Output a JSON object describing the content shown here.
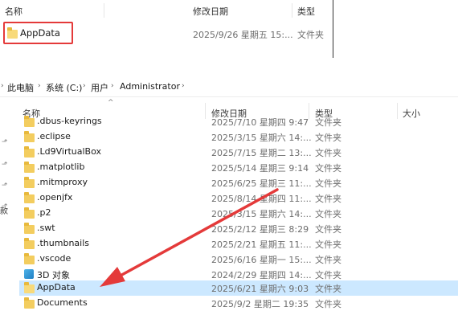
{
  "top_panel": {
    "columns": {
      "name": "名称",
      "date": "修改日期",
      "type": "类型"
    },
    "row": {
      "name": "AppData",
      "date": "2025/9/26 星期五 15:...",
      "type": "文件夹"
    },
    "highlight_color": "#e43a3a"
  },
  "breadcrumb": {
    "items": [
      "此电脑",
      "系统 (C:)",
      "用户",
      "Administrator"
    ],
    "separator": ">"
  },
  "columns": {
    "name": "名称",
    "date": "修改日期",
    "type": "类型",
    "size": "大小"
  },
  "rows": [
    {
      "name": ".dbus-keyrings",
      "date": "2025/7/10 星期四 9:47",
      "type": "文件夹",
      "icon": "folder"
    },
    {
      "name": ".eclipse",
      "date": "2025/3/15 星期六 14:...",
      "type": "文件夹",
      "icon": "folder"
    },
    {
      "name": ".Ld9VirtualBox",
      "date": "2025/7/15 星期二 13:...",
      "type": "文件夹",
      "icon": "folder"
    },
    {
      "name": ".matplotlib",
      "date": "2025/5/14 星期三 9:14",
      "type": "文件夹",
      "icon": "folder"
    },
    {
      "name": ".mitmproxy",
      "date": "2025/6/25 星期三 11:...",
      "type": "文件夹",
      "icon": "folder"
    },
    {
      "name": ".openjfx",
      "date": "2025/8/14 星期四 11:...",
      "type": "文件夹",
      "icon": "folder"
    },
    {
      "name": ".p2",
      "date": "2025/3/15 星期六 14:...",
      "type": "文件夹",
      "icon": "folder"
    },
    {
      "name": ".swt",
      "date": "2025/2/12 星期三 8:29",
      "type": "文件夹",
      "icon": "folder"
    },
    {
      "name": ".thumbnails",
      "date": "2025/2/21 星期五 11:...",
      "type": "文件夹",
      "icon": "folder"
    },
    {
      "name": ".vscode",
      "date": "2025/6/16 星期一 15:...",
      "type": "文件夹",
      "icon": "folder"
    },
    {
      "name": "3D 对象",
      "date": "2024/2/29 星期四 14:...",
      "type": "文件夹",
      "icon": "3d-objects"
    },
    {
      "name": "AppData",
      "date": "2025/6/21 星期六 9:03",
      "type": "文件夹",
      "icon": "folder",
      "selected": true
    },
    {
      "name": "Documents",
      "date": "2025/9/2 星期二 19:35",
      "type": "文件夹",
      "icon": "folder"
    }
  ],
  "selection_color": "#cce8ff",
  "arrow_color": "#e43a3a"
}
